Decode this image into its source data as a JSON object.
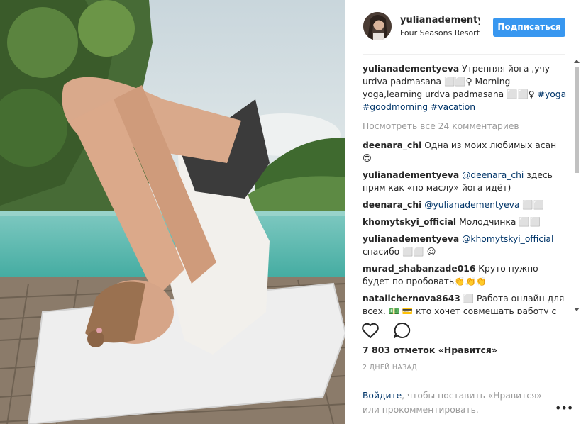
{
  "post": {
    "username": "yulianadementyeva",
    "username_short": "yulianadementyeva",
    "location": "Four Seasons Resort",
    "follow_label": "Подписаться"
  },
  "caption": {
    "username": "yulianadementyeva",
    "text": "Утренняя йога ,учу urdva padmasana ⬜⬜♀ Morning yoga,learning urdva padmasana ⬜⬜♀",
    "tags": [
      "#yoga",
      "#goodmorning",
      "#vacation"
    ]
  },
  "view_all": "Посмотреть все 24 комментариев",
  "comments": [
    {
      "user": "deenara_chi",
      "mention": "",
      "text": "Одна из моих любимых асан 😍"
    },
    {
      "user": "yulianadementyeva",
      "mention": "@deenara_chi",
      "text": "здесь прям как «по маслу» йога идёт)"
    },
    {
      "user": "deenara_chi",
      "mention": "@yulianadementyeva",
      "text": "⬜⬜"
    },
    {
      "user": "khomytskyi_official",
      "mention": "",
      "text": "Молодчинка ⬜⬜"
    },
    {
      "user": "yulianadementyeva",
      "mention": "@khomytskyi_official",
      "text": "спасибо ⬜⬜ ☺"
    },
    {
      "user": "murad_shabanzade016",
      "mention": "",
      "text": "Круто нужно будет по пробовать👏👏👏"
    },
    {
      "user": "natalichernova8643",
      "mention": "",
      "text": "⬜ Работа онлайн для всех. 💵 💳 кто хочет совмещать работу с"
    }
  ],
  "actions": {
    "like_icon": "heart-icon",
    "comment_icon": "comment-icon"
  },
  "likes": "7 803 отметок «Нравится»",
  "time": "2 ДНЕЙ НАЗАД",
  "login": {
    "link": "Войдите",
    "rest": ", чтобы поставить «Нравится» или прокомментировать."
  },
  "more": "•••"
}
